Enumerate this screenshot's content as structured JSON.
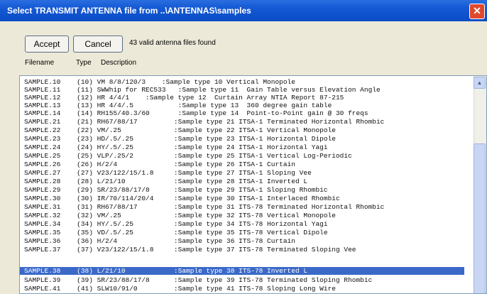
{
  "window": {
    "title": "Select TRANSMIT ANTENNA file from ..\\ANTENNAS\\samples",
    "close_glyph": "✕"
  },
  "toolbar": {
    "accept_label": "Accept",
    "cancel_label": "Cancel",
    "found_text": "43 valid antenna files found"
  },
  "columns": {
    "filename": "Filename",
    "type": "Type",
    "description": "Description"
  },
  "scrollbar": {
    "up_glyph": "▲"
  },
  "rows": [
    "SAMPLE.10    (10) VM 8/8/120/3    :Sample type 10 Vertical Monopole",
    "SAMPLE.11    (11) SWWhip for REC533   :Sample type 11  Gain Table versus Elevation Angle",
    "SAMPLE.12    (12) HR 4/4/1    :Sample type 12  Curtain Array NTIA Report 87-215",
    "SAMPLE.13    (13) HR 4/4/.5           :Sample type 13  360 degree gain table",
    "SAMPLE.14    (14) RH155/40.3/60       :Sample type 14  Point-to-Point gain @ 30 freqs",
    "SAMPLE.21    (21) RH67/88/17         :Sample type 21 ITSA-1 Terminated Horizontal Rhombic",
    "SAMPLE.22    (22) VM/.25             :Sample type 22 ITSA-1 Vertical Monopole",
    "SAMPLE.23    (23) HD/.5/.25          :Sample type 23 ITSA-1 Horizontal Dipole",
    "SAMPLE.24    (24) HY/.5/.25          :Sample type 24 ITSA-1 Horizontal Yagi",
    "SAMPLE.25    (25) VLP/.25/2          :Sample type 25 ITSA-1 Vertical Log-Periodic",
    "SAMPLE.26    (26) H/2/4              :Sample type 26 ITSA-1 Curtain",
    "SAMPLE.27    (27) V23/122/15/1.8     :Sample type 27 ITSA-1 Sloping Vee",
    "SAMPLE.28    (28) L/21/10            :Sample type 28 ITSA-1 Inverted L",
    "SAMPLE.29    (29) SR/23/88/17/8      :Sample type 29 ITSA-1 Sloping Rhombic",
    "SAMPLE.30    (30) IR/70/114/20/4     :Sample type 30 ITSA-1 Interlaced Rhombic",
    "SAMPLE.31    (31) RH67/88/17         :Sample type 31 ITS-78 Terminated Horizontal Rhombic",
    "SAMPLE.32    (32) VM/.25             :Sample type 32 ITS-78 Vertical Monopole",
    "SAMPLE.34    (34) HY/.5/.25          :Sample type 34 ITS-78 Horizontal Yagi",
    "SAMPLE.35    (35) VD/.5/.25          :Sample type 35 ITS-78 Vertical Dipole",
    "SAMPLE.36    (36) H/2/4              :Sample type 36 ITS-78 Curtain",
    "SAMPLE.37    (37) V23/122/15/1.8     :Sample type 37 ITS-78 Terminated Sloping Vee",
    "SAMPLE.38    (38) L/21/10            :Sample type 38 ITS-78 Inverted L",
    "SAMPLE.39    (39) SR/23/88/17/8      :Sample type 39 ITS-78 Terminated Sloping Rhombic",
    "SAMPLE.41    (41) SLW10/91/0         :Sample type 41 ITS-78 Sloping Long Wire"
  ]
}
